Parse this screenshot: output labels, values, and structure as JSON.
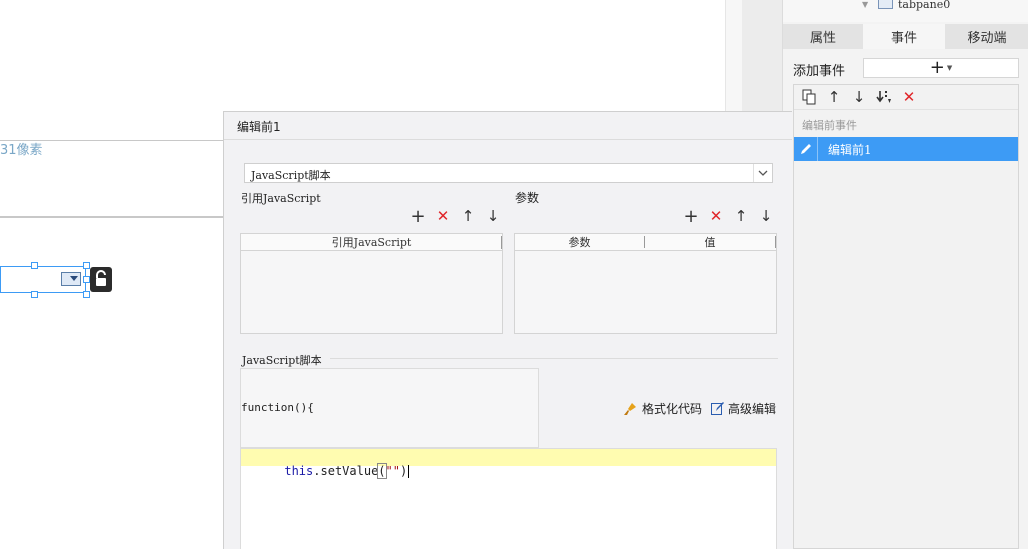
{
  "tree": {
    "node_label": "tabpane0"
  },
  "canvas": {
    "size_text": "31像素"
  },
  "panel": {
    "tabs": [
      "属性",
      "事件",
      "移动端"
    ],
    "add_event_label": "添加事件",
    "add_symbol": "+",
    "group_label": "编辑前事件",
    "selected_event": "编辑前1"
  },
  "dialog": {
    "title": "编辑前1",
    "script_type": "JavaScript脚本",
    "ref_section_label": "引用JavaScript",
    "ref_table_header": "引用JavaScript",
    "param_section_label": "参数",
    "param_headers": [
      "参数",
      "值"
    ],
    "script_section_label": "JavaScript脚本",
    "function_header": "function(){",
    "format_code_label": "格式化代码",
    "advanced_edit_label": "高级编辑",
    "code_keyword": "this",
    "code_method": ".setValue",
    "code_open": "(",
    "code_string": "\"\"",
    "code_close": ")"
  },
  "colors": {
    "accent": "#3d9bf5",
    "red": "#e0262a",
    "code_highlight": "#fffcb0",
    "keyword": "#1a1aa6",
    "string": "#a31515"
  }
}
